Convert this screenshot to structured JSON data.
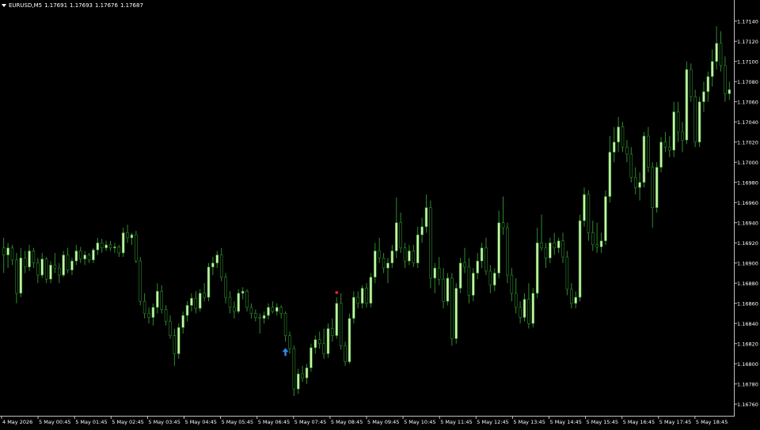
{
  "header": {
    "symbol": "EURUSD,M5",
    "open": "1.17691",
    "high": "1.17693",
    "low": "1.17676",
    "close": "1.17687"
  },
  "colors": {
    "background": "#000000",
    "bull_body": "#c8f5a8",
    "bear_body": "#000000",
    "candle_outline": "#2e8b2e",
    "wick": "#2e8b2e",
    "axis": "#c0c0c0",
    "text": "#ffffff",
    "buy_arrow": "#2a8cf0",
    "sell_marker": "#ff2020"
  },
  "chart_data": {
    "type": "candlestick",
    "ylim": [
      1.1675,
      1.1715
    ],
    "y_ticks": [
      "1.17140",
      "1.17120",
      "1.17100",
      "1.17080",
      "1.17060",
      "1.17040",
      "1.17020",
      "1.17000",
      "1.16980",
      "1.16960",
      "1.16940",
      "1.16920",
      "1.16900",
      "1.16880",
      "1.16860",
      "1.16840",
      "1.16820",
      "1.16800",
      "1.16780",
      "1.16760"
    ],
    "x_ticks": [
      "4 May 2026",
      "5 May 00:45",
      "5 May 01:45",
      "5 May 02:45",
      "5 May 03:45",
      "5 May 04:45",
      "5 May 05:45",
      "5 May 06:45",
      "5 May 07:45",
      "5 May 08:45",
      "5 May 09:45",
      "5 May 10:45",
      "5 May 11:45",
      "5 May 12:45",
      "5 May 13:45",
      "5 May 14:45",
      "5 May 15:45",
      "5 May 16:45",
      "5 May 17:45",
      "5 May 18:45"
    ],
    "candles": [
      [
        1.16915,
        1.16925,
        1.1689,
        1.16908
      ],
      [
        1.16908,
        1.1692,
        1.16895,
        1.16915
      ],
      [
        1.16915,
        1.16918,
        1.16898,
        1.16903
      ],
      [
        1.16903,
        1.1691,
        1.1686,
        1.1687
      ],
      [
        1.1687,
        1.16915,
        1.16866,
        1.16905
      ],
      [
        1.16905,
        1.16912,
        1.1689,
        1.16896
      ],
      [
        1.16896,
        1.16918,
        1.16892,
        1.16912
      ],
      [
        1.16912,
        1.16915,
        1.16895,
        1.169
      ],
      [
        1.169,
        1.16905,
        1.1688,
        1.16888
      ],
      [
        1.16888,
        1.1691,
        1.16885,
        1.16904
      ],
      [
        1.16904,
        1.16906,
        1.1688,
        1.16884
      ],
      [
        1.16884,
        1.16902,
        1.1688,
        1.16898
      ],
      [
        1.16898,
        1.1691,
        1.1689,
        1.16895
      ],
      [
        1.16895,
        1.169,
        1.1688,
        1.16888
      ],
      [
        1.16888,
        1.16912,
        1.16886,
        1.16908
      ],
      [
        1.16908,
        1.16915,
        1.1689,
        1.16893
      ],
      [
        1.16893,
        1.16905,
        1.16888,
        1.16902
      ],
      [
        1.16902,
        1.16918,
        1.16898,
        1.16912
      ],
      [
        1.16912,
        1.16916,
        1.169,
        1.16904
      ],
      [
        1.16904,
        1.16912,
        1.16898,
        1.16908
      ],
      [
        1.16908,
        1.1691,
        1.169,
        1.16903
      ],
      [
        1.16903,
        1.16915,
        1.169,
        1.16913
      ],
      [
        1.16913,
        1.16925,
        1.16908,
        1.1692
      ],
      [
        1.1692,
        1.16924,
        1.1691,
        1.16915
      ],
      [
        1.16915,
        1.16922,
        1.16912,
        1.16918
      ],
      [
        1.16918,
        1.16922,
        1.16912,
        1.16915
      ],
      [
        1.16915,
        1.1692,
        1.1691,
        1.16916
      ],
      [
        1.16916,
        1.16918,
        1.16906,
        1.1691
      ],
      [
        1.1691,
        1.16935,
        1.16906,
        1.1693
      ],
      [
        1.1693,
        1.16938,
        1.1692,
        1.16925
      ],
      [
        1.16925,
        1.1693,
        1.16918,
        1.16928
      ],
      [
        1.16928,
        1.16932,
        1.169,
        1.16902
      ],
      [
        1.16902,
        1.16906,
        1.16858,
        1.16862
      ],
      [
        1.16862,
        1.1687,
        1.16845,
        1.1685
      ],
      [
        1.1685,
        1.16856,
        1.1684,
        1.16846
      ],
      [
        1.16846,
        1.1686,
        1.16838,
        1.16856
      ],
      [
        1.16856,
        1.1688,
        1.1685,
        1.16872
      ],
      [
        1.16872,
        1.16878,
        1.1685,
        1.16854
      ],
      [
        1.16854,
        1.16858,
        1.16838,
        1.16842
      ],
      [
        1.16842,
        1.16848,
        1.16825,
        1.16828
      ],
      [
        1.16828,
        1.16835,
        1.16798,
        1.1681
      ],
      [
        1.1681,
        1.1684,
        1.16805,
        1.16836
      ],
      [
        1.16836,
        1.16852,
        1.1683,
        1.16848
      ],
      [
        1.16848,
        1.16862,
        1.16842,
        1.16858
      ],
      [
        1.16858,
        1.1687,
        1.16852,
        1.16865
      ],
      [
        1.16865,
        1.16872,
        1.1685,
        1.16855
      ],
      [
        1.16855,
        1.16874,
        1.16852,
        1.1687
      ],
      [
        1.1687,
        1.1688,
        1.16862,
        1.16866
      ],
      [
        1.16866,
        1.169,
        1.16862,
        1.16896
      ],
      [
        1.16896,
        1.16906,
        1.16888,
        1.169
      ],
      [
        1.169,
        1.16912,
        1.16895,
        1.16908
      ],
      [
        1.16908,
        1.16915,
        1.16882,
        1.16886
      ],
      [
        1.16886,
        1.1689,
        1.1686,
        1.16866
      ],
      [
        1.16866,
        1.16872,
        1.1685,
        1.16856
      ],
      [
        1.16856,
        1.16862,
        1.16845,
        1.16852
      ],
      [
        1.16852,
        1.16874,
        1.1685,
        1.1687
      ],
      [
        1.1687,
        1.16876,
        1.16864,
        1.16872
      ],
      [
        1.16872,
        1.16874,
        1.16852,
        1.16856
      ],
      [
        1.16856,
        1.1686,
        1.16845,
        1.1685
      ],
      [
        1.1685,
        1.16854,
        1.16842,
        1.16846
      ],
      [
        1.16846,
        1.1685,
        1.1683,
        1.16845
      ],
      [
        1.16845,
        1.16852,
        1.1684,
        1.16848
      ],
      [
        1.16848,
        1.1686,
        1.16844,
        1.16856
      ],
      [
        1.16856,
        1.16862,
        1.1685,
        1.16852
      ],
      [
        1.16852,
        1.1686,
        1.16848,
        1.16856
      ],
      [
        1.16856,
        1.16858,
        1.16845,
        1.1685
      ],
      [
        1.1685,
        1.16852,
        1.16822,
        1.16828
      ],
      [
        1.16828,
        1.16832,
        1.1681,
        1.16815
      ],
      [
        1.16815,
        1.16818,
        1.16768,
        1.16775
      ],
      [
        1.16775,
        1.16795,
        1.1677,
        1.1679
      ],
      [
        1.1679,
        1.16798,
        1.16782,
        1.16786
      ],
      [
        1.16786,
        1.168,
        1.1678,
        1.16796
      ],
      [
        1.16796,
        1.1682,
        1.16792,
        1.16816
      ],
      [
        1.16816,
        1.16828,
        1.1681,
        1.16824
      ],
      [
        1.16824,
        1.16832,
        1.16815,
        1.1682
      ],
      [
        1.1682,
        1.16835,
        1.16805,
        1.1681
      ],
      [
        1.1681,
        1.1684,
        1.16806,
        1.16835
      ],
      [
        1.16835,
        1.16845,
        1.16822,
        1.16828
      ],
      [
        1.16828,
        1.16866,
        1.16825,
        1.1686
      ],
      [
        1.1686,
        1.1687,
        1.16814,
        1.16818
      ],
      [
        1.16818,
        1.16822,
        1.16798,
        1.16802
      ],
      [
        1.16802,
        1.1685,
        1.168,
        1.16845
      ],
      [
        1.16845,
        1.16872,
        1.1684,
        1.16866
      ],
      [
        1.16866,
        1.16872,
        1.16855,
        1.1686
      ],
      [
        1.1686,
        1.16878,
        1.16855,
        1.16875
      ],
      [
        1.16875,
        1.1688,
        1.16856,
        1.1686
      ],
      [
        1.1686,
        1.1689,
        1.16856,
        1.16886
      ],
      [
        1.16886,
        1.1692,
        1.1688,
        1.16912
      ],
      [
        1.16912,
        1.16925,
        1.169,
        1.16905
      ],
      [
        1.16905,
        1.1691,
        1.1689,
        1.16895
      ],
      [
        1.16895,
        1.16905,
        1.1688,
        1.169
      ],
      [
        1.169,
        1.16918,
        1.16895,
        1.16912
      ],
      [
        1.16912,
        1.16965,
        1.16905,
        1.1694
      ],
      [
        1.1694,
        1.1695,
        1.1691,
        1.16915
      ],
      [
        1.16915,
        1.1692,
        1.16895,
        1.16902
      ],
      [
        1.16902,
        1.16918,
        1.16898,
        1.16912
      ],
      [
        1.16912,
        1.16918,
        1.16896,
        1.169
      ],
      [
        1.169,
        1.16936,
        1.16895,
        1.16928
      ],
      [
        1.16928,
        1.16945,
        1.1692,
        1.16936
      ],
      [
        1.16936,
        1.16968,
        1.1693,
        1.16955
      ],
      [
        1.16955,
        1.16962,
        1.16875,
        1.16885
      ],
      [
        1.16885,
        1.169,
        1.1687,
        1.16895
      ],
      [
        1.16895,
        1.16906,
        1.16878,
        1.16884
      ],
      [
        1.16884,
        1.16895,
        1.16855,
        1.16862
      ],
      [
        1.16862,
        1.1689,
        1.16858,
        1.16885
      ],
      [
        1.16885,
        1.1689,
        1.16818,
        1.16825
      ],
      [
        1.16825,
        1.1688,
        1.1682,
        1.16875
      ],
      [
        1.16875,
        1.16905,
        1.1687,
        1.169
      ],
      [
        1.169,
        1.16915,
        1.1689,
        1.16896
      ],
      [
        1.16896,
        1.16905,
        1.1686,
        1.16868
      ],
      [
        1.16868,
        1.16895,
        1.16862,
        1.1689
      ],
      [
        1.1689,
        1.1691,
        1.16884,
        1.16902
      ],
      [
        1.16902,
        1.1692,
        1.16895,
        1.16915
      ],
      [
        1.16915,
        1.16925,
        1.16888,
        1.16892
      ],
      [
        1.16892,
        1.16898,
        1.1687,
        1.16878
      ],
      [
        1.16878,
        1.16895,
        1.16872,
        1.1689
      ],
      [
        1.1689,
        1.16952,
        1.16885,
        1.1694
      ],
      [
        1.1694,
        1.16966,
        1.16928,
        1.16935
      ],
      [
        1.16935,
        1.1694,
        1.1688,
        1.16888
      ],
      [
        1.16888,
        1.16895,
        1.16862,
        1.1687
      ],
      [
        1.1687,
        1.16885,
        1.1685,
        1.16856
      ],
      [
        1.16856,
        1.16862,
        1.1684,
        1.16846
      ],
      [
        1.16846,
        1.1687,
        1.16842,
        1.16864
      ],
      [
        1.16864,
        1.1688,
        1.16835,
        1.1684
      ],
      [
        1.1684,
        1.16875,
        1.16836,
        1.1687
      ],
      [
        1.1687,
        1.16935,
        1.16865,
        1.1692
      ],
      [
        1.1692,
        1.16948,
        1.16912,
        1.16915
      ],
      [
        1.16915,
        1.1692,
        1.16895,
        1.16905
      ],
      [
        1.16905,
        1.16925,
        1.169,
        1.1692
      ],
      [
        1.1692,
        1.1693,
        1.16908,
        1.16915
      ],
      [
        1.16915,
        1.16925,
        1.1691,
        1.16922
      ],
      [
        1.16922,
        1.1693,
        1.169,
        1.16906
      ],
      [
        1.16906,
        1.16912,
        1.16868,
        1.16874
      ],
      [
        1.16874,
        1.1688,
        1.16855,
        1.1686
      ],
      [
        1.1686,
        1.16872,
        1.16855,
        1.16866
      ],
      [
        1.16866,
        1.16948,
        1.16862,
        1.16942
      ],
      [
        1.16942,
        1.16975,
        1.16936,
        1.16968
      ],
      [
        1.16968,
        1.16972,
        1.16922,
        1.1693
      ],
      [
        1.1693,
        1.16942,
        1.16912,
        1.16918
      ],
      [
        1.16918,
        1.1694,
        1.1691,
        1.16916
      ],
      [
        1.16916,
        1.1693,
        1.1691,
        1.16922
      ],
      [
        1.16922,
        1.16972,
        1.16918,
        1.16966
      ],
      [
        1.16966,
        1.17026,
        1.1696,
        1.1701
      ],
      [
        1.1701,
        1.17035,
        1.17,
        1.1702
      ],
      [
        1.1702,
        1.17045,
        1.1701,
        1.17035
      ],
      [
        1.17035,
        1.1704,
        1.1701,
        1.17015
      ],
      [
        1.17015,
        1.17022,
        1.17,
        1.17008
      ],
      [
        1.17008,
        1.17015,
        1.1698,
        1.16985
      ],
      [
        1.16985,
        1.16995,
        1.16968,
        1.16975
      ],
      [
        1.16975,
        1.1699,
        1.16962,
        1.1698
      ],
      [
        1.1698,
        1.1703,
        1.16975,
        1.17026
      ],
      [
        1.17026,
        1.17035,
        1.1699,
        1.16995
      ],
      [
        1.16995,
        1.17,
        1.16935,
        1.16955
      ],
      [
        1.16955,
        1.17,
        1.1695,
        1.16995
      ],
      [
        1.16995,
        1.17025,
        1.1699,
        1.1702
      ],
      [
        1.1702,
        1.1703,
        1.1701,
        1.17015
      ],
      [
        1.17015,
        1.17026,
        1.17005,
        1.17012
      ],
      [
        1.17012,
        1.1706,
        1.17005,
        1.1705
      ],
      [
        1.1705,
        1.1706,
        1.1702,
        1.1703
      ],
      [
        1.1703,
        1.1704,
        1.1701,
        1.17022
      ],
      [
        1.17022,
        1.171,
        1.17018,
        1.17092
      ],
      [
        1.17092,
        1.17098,
        1.1706,
        1.17065
      ],
      [
        1.17065,
        1.17072,
        1.17015,
        1.1702
      ],
      [
        1.1702,
        1.17065,
        1.17015,
        1.1706
      ],
      [
        1.1706,
        1.1708,
        1.1705,
        1.1707
      ],
      [
        1.1707,
        1.1709,
        1.1706,
        1.17085
      ],
      [
        1.17085,
        1.17112,
        1.17075,
        1.171
      ],
      [
        1.171,
        1.17135,
        1.17092,
        1.17118
      ],
      [
        1.17118,
        1.1713,
        1.1709,
        1.17096
      ],
      [
        1.17096,
        1.17105,
        1.1706,
        1.17068
      ],
      [
        1.17068,
        1.1708,
        1.17062,
        1.17072
      ]
    ],
    "signals": [
      {
        "type": "buy",
        "candle": 66
      },
      {
        "type": "sell",
        "candle": 78
      }
    ]
  }
}
